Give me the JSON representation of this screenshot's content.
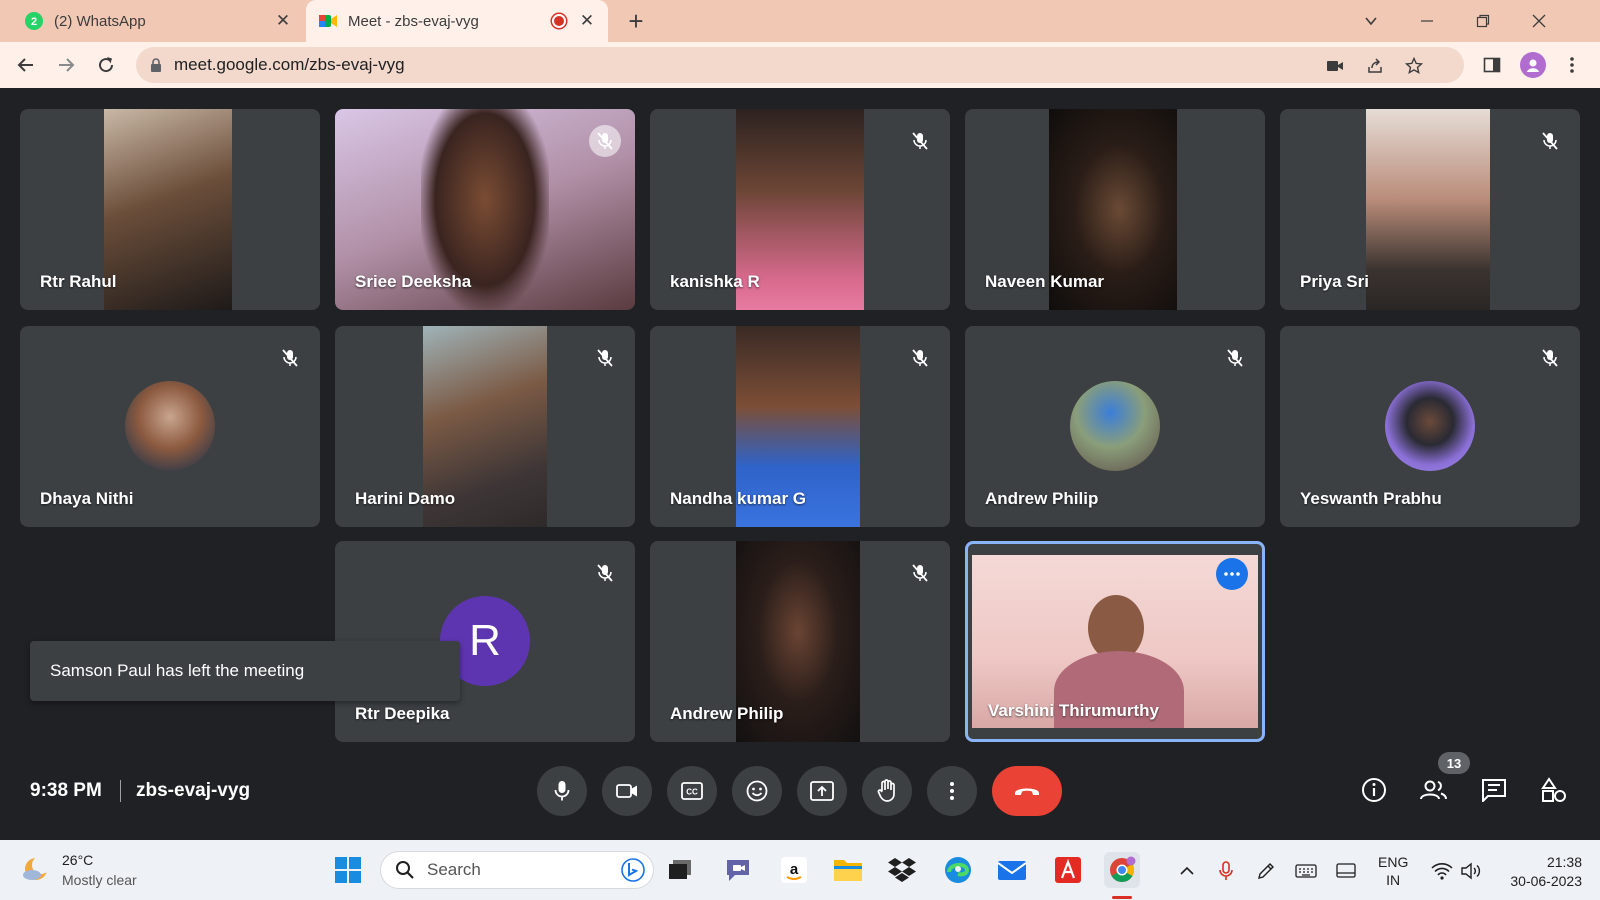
{
  "browser": {
    "tabs": [
      {
        "title": "(2) WhatsApp",
        "badge": "2"
      },
      {
        "title": "Meet - zbs-evaj-vyg"
      }
    ],
    "url": "meet.google.com/zbs-evaj-vyg"
  },
  "meeting": {
    "time": "9:38 PM",
    "code": "zbs-evaj-vyg",
    "people_count": "13",
    "toast": "Samson Paul has left the meeting",
    "participants": [
      {
        "name": "Rtr Rahul",
        "muted": false
      },
      {
        "name": "Sriee Deeksha",
        "muted": true
      },
      {
        "name": "kanishka R",
        "muted": true
      },
      {
        "name": "Naveen Kumar",
        "muted": false
      },
      {
        "name": "Priya Sri",
        "muted": true
      },
      {
        "name": "Dhaya Nithi",
        "muted": true
      },
      {
        "name": "Harini Damo",
        "muted": true
      },
      {
        "name": "Nandha kumar G",
        "muted": true
      },
      {
        "name": "Andrew Philip",
        "muted": true
      },
      {
        "name": "Yeswanth Prabhu",
        "muted": true
      },
      {
        "name": "Rtr Deepika",
        "muted": true,
        "initial": "R"
      },
      {
        "name": "Andrew Philip",
        "muted": true
      },
      {
        "name": "Varshini Thirumurthy",
        "muted": false,
        "self": true
      }
    ]
  },
  "taskbar": {
    "weather_temp": "26°C",
    "weather_cond": "Mostly clear",
    "search_placeholder": "Search",
    "lang_top": "ENG",
    "lang_bottom": "IN",
    "clock_time": "21:38",
    "clock_date": "30-06-2023"
  },
  "colors": {
    "meet_bg": "#202124",
    "tile_bg": "#3c4043",
    "end_call": "#ea4335",
    "self_border": "#8ab4f8",
    "tab_strip": "#f0c8b4"
  }
}
